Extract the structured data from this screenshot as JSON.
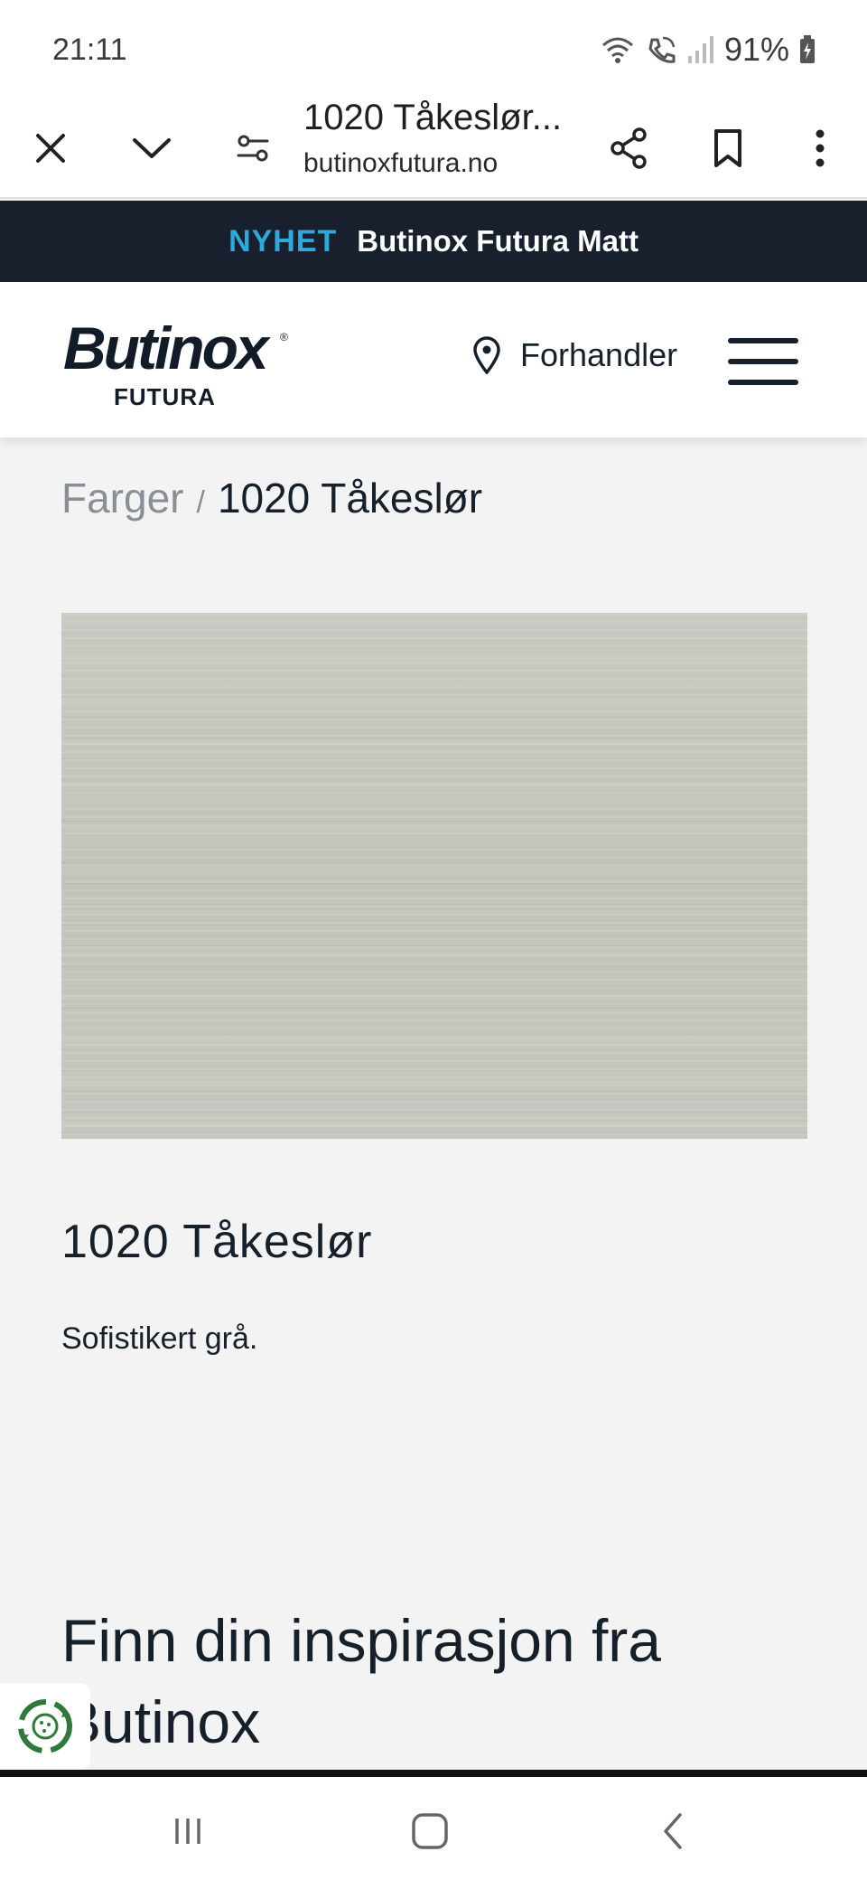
{
  "status_bar": {
    "time": "21:11",
    "battery": "91%",
    "icons": [
      "wifi-icon",
      "wifi-call-icon",
      "signal-icon",
      "battery-charging-icon"
    ]
  },
  "browser": {
    "page_title": "1020 Tåkeslør...",
    "url": "butinoxfutura.no",
    "icons": [
      "close-icon",
      "chevron-down-icon",
      "site-settings-icon",
      "share-icon",
      "bookmark-icon",
      "more-vert-icon"
    ]
  },
  "announcement": {
    "tag": "NYHET",
    "text": "Butinox Futura Matt",
    "tag_color": "#2fa8dc",
    "background": "#17202c"
  },
  "header": {
    "logo_main": "Butinox",
    "logo_sub": "FUTURA",
    "logo_reg": "®",
    "dealer_label": "Forhandler"
  },
  "breadcrumb": {
    "parent": "Farger",
    "separator": "/",
    "current": "1020 Tåkeslør"
  },
  "color": {
    "name": "1020 Tåkeslør",
    "description": "Sofistikert grå.",
    "swatch_color": "#c5c5bd"
  },
  "inspiration": {
    "heading": "Finn din inspirasjon fra Butinox"
  },
  "nav": {
    "icons": [
      "recent-apps-icon",
      "home-icon",
      "back-icon"
    ]
  }
}
